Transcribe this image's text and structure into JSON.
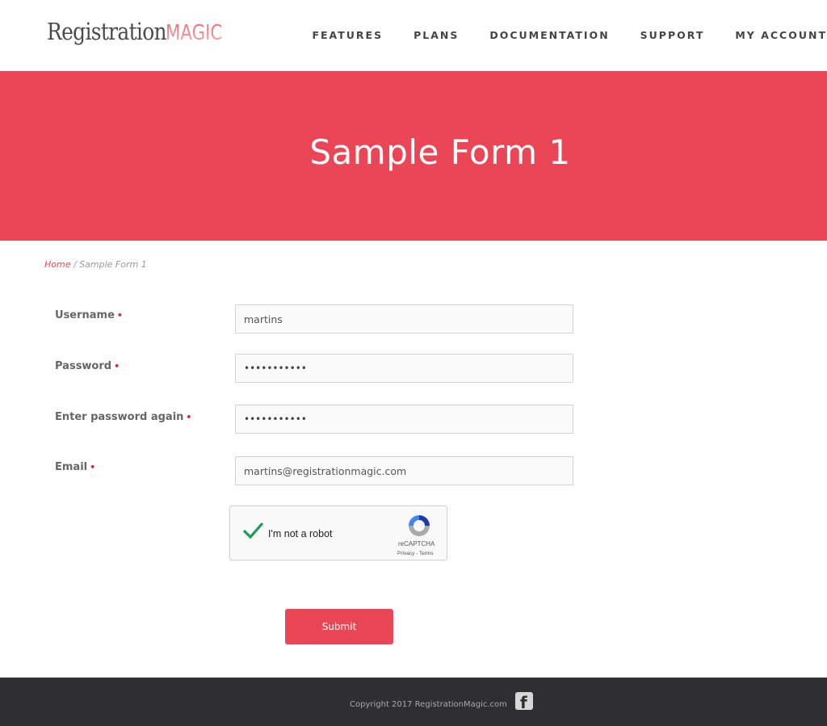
{
  "header": {
    "logo_main": "Registration",
    "logo_accent": "MAGIC",
    "nav": [
      "FEATURES",
      "PLANS",
      "DOCUMENTATION",
      "SUPPORT",
      "MY ACCOUNT"
    ]
  },
  "banner": {
    "title": "Sample Form 1"
  },
  "breadcrumb": {
    "home": "Home",
    "separator": " / ",
    "current": "Sample Form 1"
  },
  "form": {
    "required_marker": "•",
    "fields": [
      {
        "label": "Username",
        "value": "martins",
        "type": "text"
      },
      {
        "label": "Password",
        "value": "•••••••••••",
        "type": "password"
      },
      {
        "label": "Enter password again",
        "value": "•••••••••••",
        "type": "password"
      },
      {
        "label": "Email",
        "value": "martins@registrationmagic.com",
        "type": "email"
      }
    ],
    "captcha": {
      "label": "I'm not a robot",
      "checked": true,
      "brand": "reCAPTCHA",
      "links": "Privacy - Terms"
    },
    "submit_label": "Submit"
  },
  "footer": {
    "copyright": "Copyright 2017 RegistrationMagic.com",
    "social_icon": "facebook-icon"
  },
  "colors": {
    "accent": "#ea4656",
    "footer_bg": "#2f2f31",
    "check": "#1e9b5a"
  }
}
